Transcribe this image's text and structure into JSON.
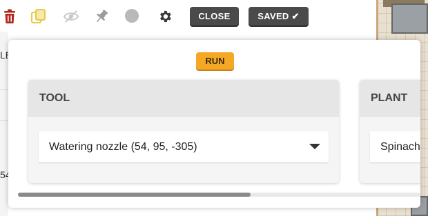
{
  "toolbar": {
    "icons": [
      "trash-icon",
      "copy-icon",
      "eye-off-icon",
      "pin-icon",
      "color-dot-icon",
      "gear-icon"
    ],
    "close_label": "CLOSE",
    "saved_label": "SAVED ✔"
  },
  "popup": {
    "run_label": "RUN",
    "cards": [
      {
        "header": "TOOL",
        "value": "Watering nozzle (54, 95, -305)"
      },
      {
        "header": "PLANT",
        "value": "Spinach"
      }
    ]
  },
  "background": {
    "left_fragments": [
      "LE",
      "54"
    ]
  },
  "colors": {
    "trash": "#b0271b",
    "copy": "#e6c84a",
    "run": "#f4a825",
    "dark_button": "#4a4a4a"
  }
}
